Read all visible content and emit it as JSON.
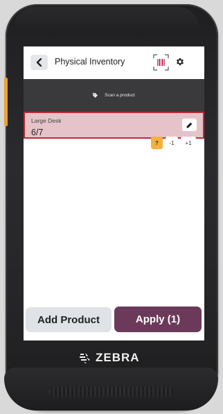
{
  "device": {
    "brand": "ZEBRA"
  },
  "header": {
    "title": "Physical Inventory",
    "back_icon": "chevron-left-icon",
    "scan_icon": "barcode-scan-icon",
    "settings_icon": "gear-icon"
  },
  "banner": {
    "icon": "tag-icon",
    "text": "Scan a product"
  },
  "line_items": [
    {
      "name": "Large Desk",
      "quantity": "6/7",
      "unknown_label": "?",
      "decrement_label": "-1",
      "increment_label": "+1",
      "status_color": "#c0282f"
    }
  ],
  "footer": {
    "add_label": "Add Product",
    "apply_label": "Apply (1)"
  },
  "colors": {
    "accent": "#6b3a5a",
    "warning": "#f5b13f",
    "banner_bg": "#3a3a3c"
  }
}
